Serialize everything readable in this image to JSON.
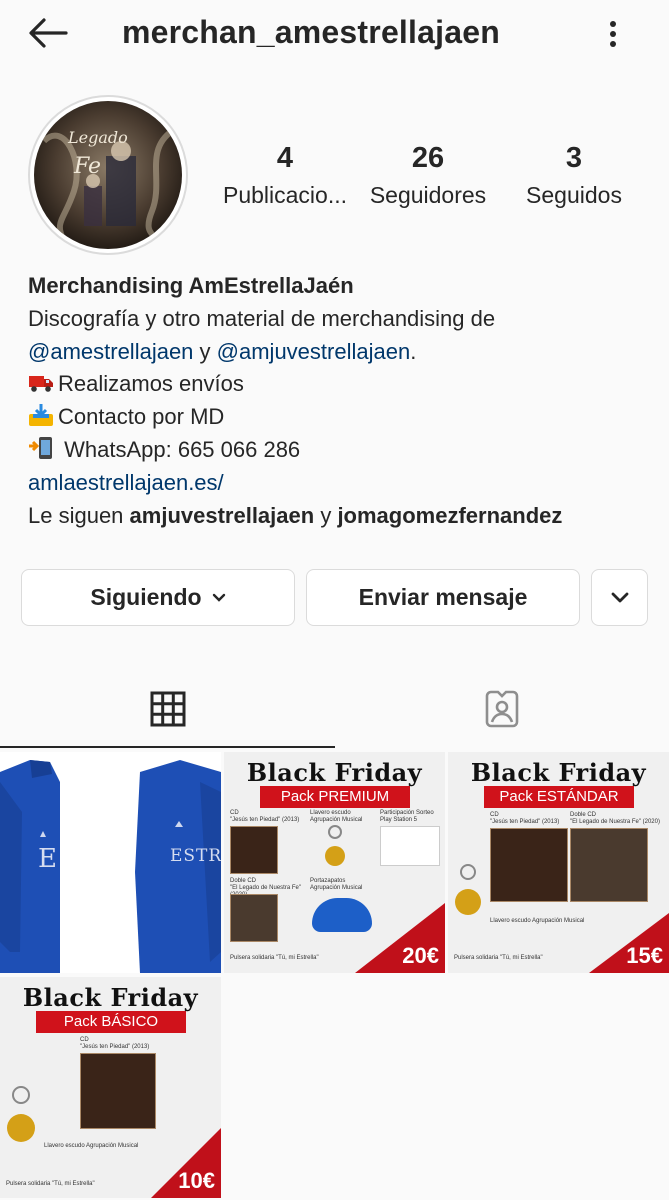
{
  "header": {
    "username": "merchan_amestrellajaen"
  },
  "avatar": {
    "text_line1": "Legado",
    "text_line2": "Fe"
  },
  "stats": [
    {
      "num": "4",
      "label": "Publicacio..."
    },
    {
      "num": "26",
      "label": "Seguidores"
    },
    {
      "num": "3",
      "label": "Seguidos"
    }
  ],
  "bio": {
    "name": "Merchandising AmEstrellaJaén",
    "line1": "Discografía y otro material de merchandising de",
    "mention1": "@amestrellajaen",
    "and1": " y ",
    "mention2": "@amjuvestrellajaen",
    "period": ".",
    "line_shipping": "Realizamos envíos",
    "line_contact": "Contacto por MD",
    "line_whatsapp": " WhatsApp: 665 066 286",
    "website": "amlaestrellajaen.es/",
    "followed_prefix": "Le siguen ",
    "followed_user1": "amjuvestrellajaen",
    "followed_and": " y ",
    "followed_user2": "jomagomezfernandez"
  },
  "buttons": {
    "following": "Siguiendo",
    "message": "Enviar mensaje"
  },
  "posts": [
    {
      "kind": "jacket",
      "text": "ESTRE"
    },
    {
      "kind": "pack",
      "title": "Black Friday",
      "pack": "Pack PREMIUM",
      "price": "20€",
      "items": [
        "CD",
        "\"Jesús ten Piedad\" (2013)",
        "Llavero escudo Agrupación Musical",
        "Participación Sorteo Play Station 5",
        "Doble CD",
        "\"El Legado de Nuestra Fe\" (2020)",
        "Portazapatos Agrupación Musical",
        "Pulsera solidaria \"Tú, mi Estrella\""
      ]
    },
    {
      "kind": "pack",
      "title": "Black Friday",
      "pack": "Pack ESTÁNDAR",
      "price": "15€",
      "items": [
        "CD",
        "\"Jesús ten Piedad\" (2013)",
        "Doble CD",
        "\"El Legado de Nuestra Fe\" (2020)",
        "Llavero escudo Agrupación Musical",
        "Pulsera solidaria \"Tú, mi Estrella\""
      ]
    },
    {
      "kind": "pack",
      "title": "Black Friday",
      "pack": "Pack BÁSICO",
      "price": "10€",
      "items": [
        "CD",
        "\"Jesús ten Piedad\" (2013)",
        "Llavero escudo Agrupación Musical",
        "Pulsera solidaria \"Tú, mi Estrella\""
      ]
    }
  ],
  "colors": {
    "link": "#00376b",
    "brand_red": "#d0121b",
    "border": "#dbdbdb"
  },
  "icons": [
    "back-arrow-icon",
    "more-vertical-icon",
    "chevron-down-icon",
    "grid-icon",
    "tagged-icon",
    "truck-emoji-icon",
    "inbox-emoji-icon",
    "phone-emoji-icon"
  ]
}
